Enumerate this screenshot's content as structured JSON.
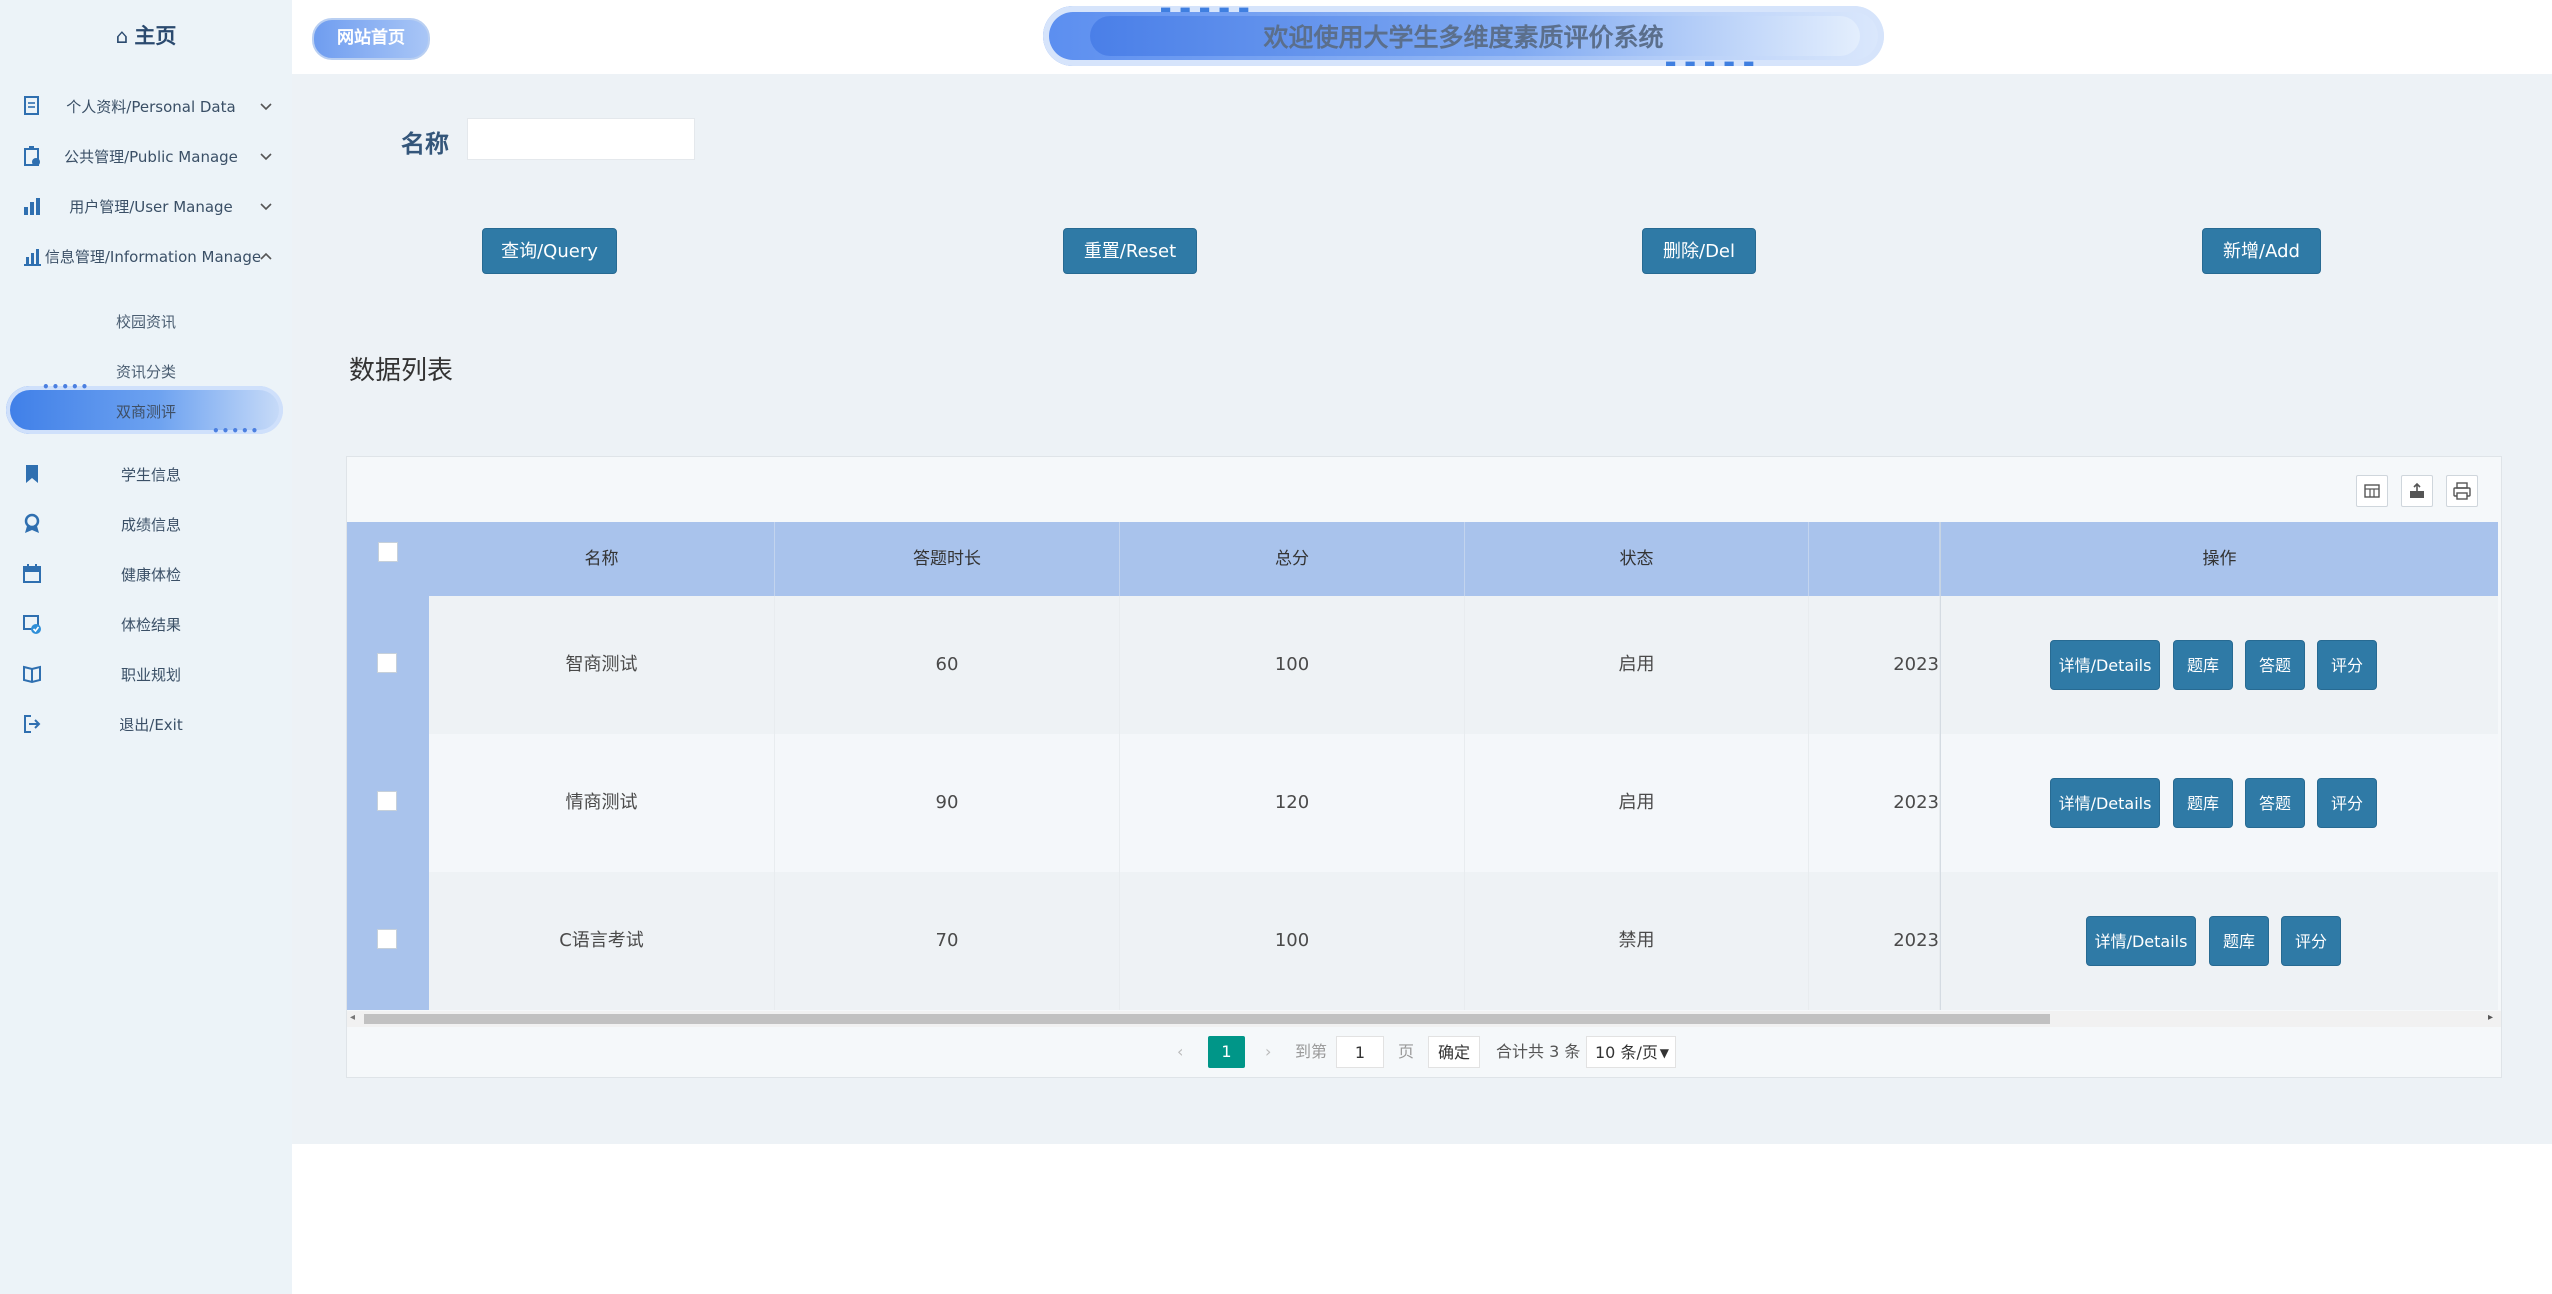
{
  "sidebar": {
    "home_label": "主页",
    "menus": [
      {
        "label": "个人资料/Personal Data",
        "icon": "document-icon"
      },
      {
        "label": "公共管理/Public Manage",
        "icon": "clipboard-icon"
      },
      {
        "label": "用户管理/User Manage",
        "icon": "users-chart-icon"
      },
      {
        "label": "信息管理/Information Manage",
        "icon": "bar-chart-icon"
      }
    ],
    "submenu": [
      "校园资讯",
      "资讯分类",
      "双商测评"
    ],
    "active_submenu": "双商测评",
    "items": [
      {
        "label": "学生信息",
        "icon": "bookmark-icon"
      },
      {
        "label": "成绩信息",
        "icon": "award-icon"
      },
      {
        "label": "健康体检",
        "icon": "calendar-icon"
      },
      {
        "label": "体检结果",
        "icon": "calendar-check-icon"
      },
      {
        "label": "职业规划",
        "icon": "book-icon"
      },
      {
        "label": "退出/Exit",
        "icon": "logout-icon"
      }
    ]
  },
  "header": {
    "site_home": "网站首页",
    "banner_title": "欢迎使用大学生多维度素质评价系统"
  },
  "search": {
    "label": "名称",
    "value": ""
  },
  "actions": {
    "query": "查询/Query",
    "reset": "重置/Reset",
    "delete": "删除/Del",
    "add": "新增/Add"
  },
  "list": {
    "title": "数据列表",
    "columns": [
      "名称",
      "答题时长",
      "总分",
      "状态",
      ""
    ],
    "ops_header": "操作",
    "rows": [
      {
        "name": "智商测试",
        "duration": "60",
        "score": "100",
        "status": "启用",
        "date": "2023",
        "ops": [
          "详情/Details",
          "题库",
          "答题",
          "评分"
        ]
      },
      {
        "name": "情商测试",
        "duration": "90",
        "score": "120",
        "status": "启用",
        "date": "2023",
        "ops": [
          "详情/Details",
          "题库",
          "答题",
          "评分"
        ]
      },
      {
        "name": "C语言考试",
        "duration": "70",
        "score": "100",
        "status": "禁用",
        "date": "2023",
        "ops": [
          "详情/Details",
          "题库",
          "评分"
        ]
      }
    ]
  },
  "pagination": {
    "current_page": "1",
    "goto_label": "到第",
    "goto_value": "1",
    "page_unit": "页",
    "confirm": "确定",
    "total": "合计共 3 条",
    "page_size": "10 条/页"
  },
  "colors": {
    "primary_button": "#2f7aa6",
    "table_header": "#a9c3ec",
    "pager_active": "#009688",
    "sidebar_bg": "#ecf3f8"
  }
}
